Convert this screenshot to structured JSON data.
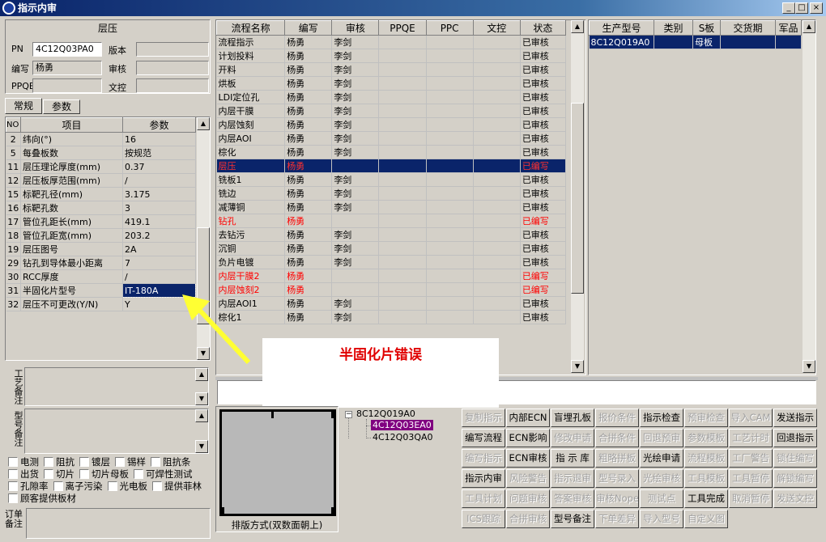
{
  "window": {
    "title": "指示内审"
  },
  "left": {
    "section_title": "层压",
    "fields": {
      "pn_label": "PN",
      "pn_value": "4C12Q03PA0",
      "version_label": "版本",
      "version_value": "",
      "writer_label": "编写",
      "writer_value": "杨勇",
      "review_label": "审核",
      "review_value": "",
      "ppqe_label": "PPQE",
      "ppqe_value": "",
      "doc_label": "文控",
      "doc_value": ""
    },
    "tabs": [
      "常规",
      "参数"
    ],
    "param_headers": [
      "NO",
      "项目",
      "参数"
    ],
    "params": [
      {
        "no": "2",
        "item": "纬向(°)",
        "value": "16"
      },
      {
        "no": "5",
        "item": "每叠板数",
        "value": "按规范"
      },
      {
        "no": "11",
        "item": "层压理论厚度(mm)",
        "value": "0.37"
      },
      {
        "no": "12",
        "item": "层压板厚范围(mm)",
        "value": "/"
      },
      {
        "no": "15",
        "item": "标靶孔径(mm)",
        "value": "3.175"
      },
      {
        "no": "16",
        "item": "标靶孔数",
        "value": "3"
      },
      {
        "no": "17",
        "item": "管位孔距长(mm)",
        "value": "419.1"
      },
      {
        "no": "18",
        "item": "管位孔距宽(mm)",
        "value": "203.2"
      },
      {
        "no": "19",
        "item": "层压图号",
        "value": "2A"
      },
      {
        "no": "29",
        "item": "钻孔到导体最小距离",
        "value": "7"
      },
      {
        "no": "30",
        "item": "RCC厚度",
        "value": "/"
      },
      {
        "no": "31",
        "item": "半固化片型号",
        "value": "IT-180A"
      },
      {
        "no": "32",
        "item": "层压不可更改(Y/N)",
        "value": "Y"
      }
    ],
    "remark1_label": "工艺备注",
    "remark2_label": "型号备注",
    "checkboxes": [
      [
        "电测",
        "阻抗",
        "镀层",
        "锡样",
        "阻抗条"
      ],
      [
        "出货",
        "切片",
        "切片母板",
        "可焊性测试"
      ],
      [
        "孔隙率",
        "离子污染",
        "光电板",
        "提供菲林"
      ],
      [
        "顾客提供板材"
      ]
    ],
    "order_label": "订单备注"
  },
  "process": {
    "headers": [
      "流程名称",
      "编写",
      "审核",
      "PPQE",
      "PPC",
      "文控",
      "状态"
    ],
    "rows": [
      {
        "name": "流程指示",
        "writer": "杨勇",
        "reviewer": "李剑",
        "status": "已审核"
      },
      {
        "name": "计划投料",
        "writer": "杨勇",
        "reviewer": "李剑",
        "status": "已审核"
      },
      {
        "name": "开料",
        "writer": "杨勇",
        "reviewer": "李剑",
        "status": "已审核"
      },
      {
        "name": "烘板",
        "writer": "杨勇",
        "reviewer": "李剑",
        "status": "已审核"
      },
      {
        "name": "LDI定位孔",
        "writer": "杨勇",
        "reviewer": "李剑",
        "status": "已审核"
      },
      {
        "name": "内层干膜",
        "writer": "杨勇",
        "reviewer": "李剑",
        "status": "已审核"
      },
      {
        "name": "内层蚀刻",
        "writer": "杨勇",
        "reviewer": "李剑",
        "status": "已审核"
      },
      {
        "name": "内层AOI",
        "writer": "杨勇",
        "reviewer": "李剑",
        "status": "已审核"
      },
      {
        "name": "棕化",
        "writer": "杨勇",
        "reviewer": "李剑",
        "status": "已审核"
      },
      {
        "name": "层压",
        "writer": "杨勇",
        "reviewer": "",
        "status": "已编写"
      },
      {
        "name": "铣板1",
        "writer": "杨勇",
        "reviewer": "李剑",
        "status": "已审核"
      },
      {
        "name": "铣边",
        "writer": "杨勇",
        "reviewer": "李剑",
        "status": "已审核"
      },
      {
        "name": "减薄铜",
        "writer": "杨勇",
        "reviewer": "李剑",
        "status": "已审核"
      },
      {
        "name": "钻孔",
        "writer": "杨勇",
        "reviewer": "",
        "status": "已编写"
      },
      {
        "name": "去钻污",
        "writer": "杨勇",
        "reviewer": "李剑",
        "status": "已审核"
      },
      {
        "name": "沉铜",
        "writer": "杨勇",
        "reviewer": "李剑",
        "status": "已审核"
      },
      {
        "name": "负片电镀",
        "writer": "杨勇",
        "reviewer": "李剑",
        "status": "已审核"
      },
      {
        "name": "内层干膜2",
        "writer": "杨勇",
        "reviewer": "",
        "status": "已编写"
      },
      {
        "name": "内层蚀刻2",
        "writer": "杨勇",
        "reviewer": "",
        "status": "已编写"
      },
      {
        "name": "内层AOI1",
        "writer": "杨勇",
        "reviewer": "李剑",
        "status": "已审核"
      },
      {
        "name": "棕化1",
        "writer": "杨勇",
        "reviewer": "李剑",
        "status": "已审核"
      }
    ]
  },
  "production": {
    "headers": [
      "生产型号",
      "类别",
      "S板",
      "交货期",
      "军品"
    ],
    "rows": [
      {
        "model": "8C12Q019A0",
        "category": "",
        "s_board": "母板",
        "delivery": "",
        "military": ""
      }
    ]
  },
  "annotation": {
    "text": "半固化片错误",
    "color": "#e00000",
    "arrow_color": "#ffff33"
  },
  "preview": {
    "caption": "排版方式(双数面朝上)"
  },
  "tree": {
    "root": "8C12Q019A0",
    "children": [
      "4C12Q03EA0",
      "4C12Q03QA0"
    ],
    "selected_index": 0
  },
  "buttons": [
    [
      "复制指示",
      "内部ECN",
      "盲埋孔板",
      "报价条件",
      "指示检查",
      "预审检查",
      "导入CAM",
      "发送指示"
    ],
    [
      "编写流程",
      "ECN影响",
      "修改申请",
      "合拼条件",
      "回退预审",
      "参数模板",
      "工艺计时",
      "回退指示"
    ],
    [
      "编写指示",
      "ECN审核",
      "指 示 库",
      "粗略拼板",
      "光绘申请",
      "流程模板",
      "工厂警告",
      "锁住编写"
    ],
    [
      "指示内审",
      "风险警告",
      "指示退审",
      "型号录入",
      "光绘审核",
      "工具模板",
      "工具暂停",
      "解锁编写"
    ],
    [
      "工具计划",
      "问题审核",
      "答案审核",
      "审核Nope",
      "测试点",
      "工具完成",
      "取消暂停",
      "发送文控"
    ],
    [
      "ICS跟踪",
      "合拼审核",
      "型号备注",
      "下单差异",
      "导入型号",
      "自定义图"
    ]
  ],
  "buttons_disabled": [
    [
      true,
      false,
      false,
      true,
      false,
      true,
      true,
      false
    ],
    [
      false,
      false,
      true,
      true,
      true,
      true,
      true,
      false
    ],
    [
      true,
      false,
      false,
      true,
      false,
      true,
      true,
      true
    ],
    [
      false,
      true,
      true,
      true,
      true,
      true,
      true,
      true
    ],
    [
      true,
      true,
      true,
      true,
      true,
      false,
      true,
      true
    ],
    [
      true,
      true,
      false,
      true,
      true,
      true
    ]
  ]
}
